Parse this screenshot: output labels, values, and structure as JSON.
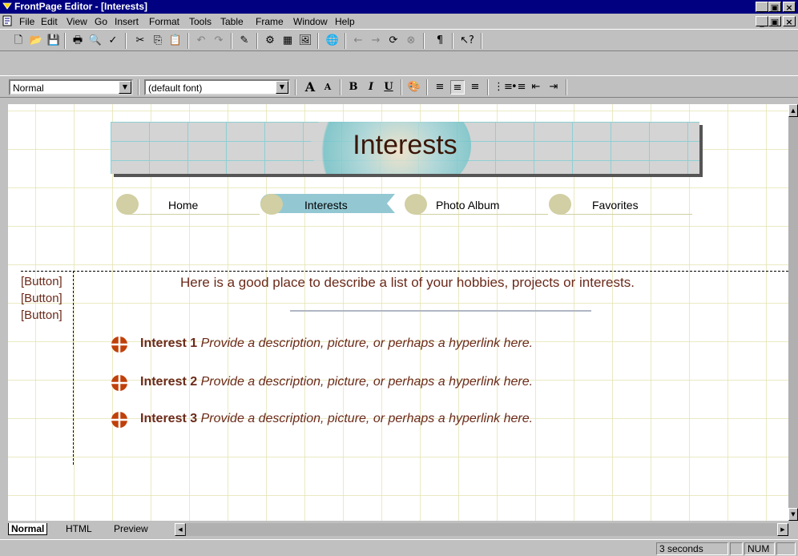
{
  "window": {
    "title": "FrontPage Editor - [Interests]",
    "controls": [
      "_",
      "▣",
      "×"
    ]
  },
  "menu": [
    "File",
    "Edit",
    "View",
    "Go",
    "Insert",
    "Format",
    "Tools",
    "Table",
    "Frame",
    "Window",
    "Help"
  ],
  "toolbar": {
    "style_value": "Normal",
    "font_value": "(default font)"
  },
  "page": {
    "banner_title": "Interests",
    "nav": [
      "Home",
      "Interests",
      "Photo Album",
      "Favorites"
    ],
    "nav_active": "Interests",
    "buttons": [
      "[Button]",
      "[Button]",
      "[Button]"
    ],
    "intro": "Here is a good place to describe a list of your hobbies, projects or interests.",
    "interests": [
      {
        "name": "Interest 1",
        "desc": "Provide a description, picture, or perhaps a hyperlink here."
      },
      {
        "name": "Interest 2",
        "desc": "Provide a description, picture, or perhaps a hyperlink here."
      },
      {
        "name": "Interest 3",
        "desc": "Provide a description, picture, or perhaps a hyperlink here."
      }
    ]
  },
  "view_tabs": [
    "Normal",
    "HTML",
    "Preview"
  ],
  "status": {
    "time": "3 seconds",
    "num": "NUM"
  },
  "colors": {
    "titlebar": "#000080",
    "text_brown": "#6b2a1a",
    "bullet": "#c0400a",
    "nav_circle": "#d1cfa3",
    "nav_active": "#93c8d3"
  }
}
